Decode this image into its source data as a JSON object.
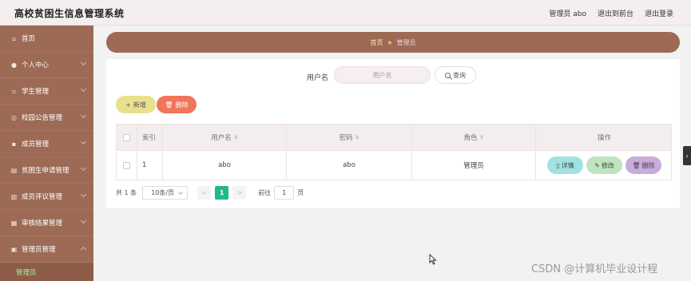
{
  "header": {
    "title": "高校贫困生信息管理系统",
    "user_label": "管理员 abo",
    "front_link": "退出到前台",
    "logout_link": "退出登录"
  },
  "sidebar": {
    "items": [
      {
        "label": "首页",
        "icon": "home-icon"
      },
      {
        "label": "个人中心",
        "icon": "user-icon"
      },
      {
        "label": "学生管理",
        "icon": "student-icon"
      },
      {
        "label": "校园公告管理",
        "icon": "notice-icon"
      },
      {
        "label": "成员管理",
        "icon": "member-icon"
      },
      {
        "label": "贫困生申请管理",
        "icon": "apply-icon"
      },
      {
        "label": "成员评议管理",
        "icon": "review-icon"
      },
      {
        "label": "审核结果管理",
        "icon": "audit-icon"
      },
      {
        "label": "管理员管理",
        "icon": "admin-icon"
      }
    ],
    "active_sub": "管理员"
  },
  "breadcrumb": {
    "home": "首页",
    "current": "管理员"
  },
  "search": {
    "label": "用户名",
    "placeholder": "用户名",
    "button": "查询"
  },
  "actions": {
    "add": "新增",
    "delete": "删除"
  },
  "table": {
    "headers": [
      "索引",
      "用户名",
      "密码",
      "角色",
      "操作"
    ],
    "rows": [
      {
        "index": "1",
        "username": "abo",
        "password": "abo",
        "role": "管理员"
      }
    ],
    "row_actions": {
      "detail": "详情",
      "edit": "修改",
      "remove": "删除"
    }
  },
  "pagination": {
    "total": "共 1 条",
    "page_size": "10条/页",
    "prev": "<",
    "current": "1",
    "next": ">",
    "goto_label": "前往",
    "goto_value": "1",
    "page_unit": "页"
  },
  "watermark": "CSDN @计算机毕业设计程",
  "colors": {
    "sidebar": "#9c6a55",
    "active_sub_text": "#9ef39a",
    "page_active": "#1fb98f",
    "add_button": "#e9e08c",
    "delete_button": "#f0755a"
  }
}
